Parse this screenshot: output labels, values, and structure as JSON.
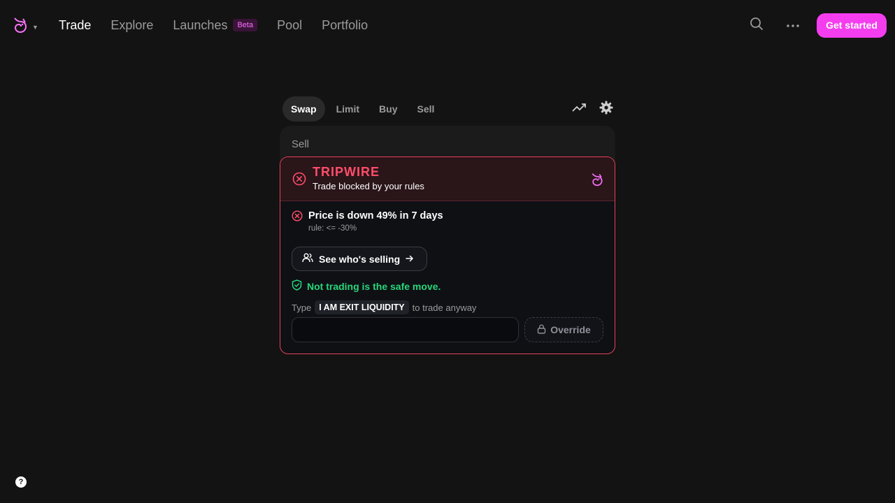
{
  "nav": {
    "links": [
      {
        "label": "Trade"
      },
      {
        "label": "Explore"
      },
      {
        "label": "Launches",
        "badge": "Beta"
      },
      {
        "label": "Pool"
      },
      {
        "label": "Portfolio"
      }
    ],
    "cta_label": "Get started"
  },
  "swap": {
    "tabs": [
      "Swap",
      "Limit",
      "Buy",
      "Sell"
    ],
    "sell_label": "Sell"
  },
  "tripwire": {
    "title": "TRIPWIRE",
    "subtitle": "Trade blocked by your rules",
    "reason_title": "Price is down 49% in 7 days",
    "reason_rule": "rule: <= -30%",
    "see_button_label": "See who's selling",
    "safe_message": "Not trading is the safe move.",
    "type_prefix": "Type",
    "confirm_phrase": "I AM EXIT LIQUIDITY",
    "type_suffix": "to trade anyway",
    "input_value": "",
    "override_label": "Override"
  },
  "help_label": "?",
  "colors": {
    "accent": "#f53df0",
    "danger": "#ff4d6a",
    "success": "#27d67a",
    "background": "#131313"
  }
}
